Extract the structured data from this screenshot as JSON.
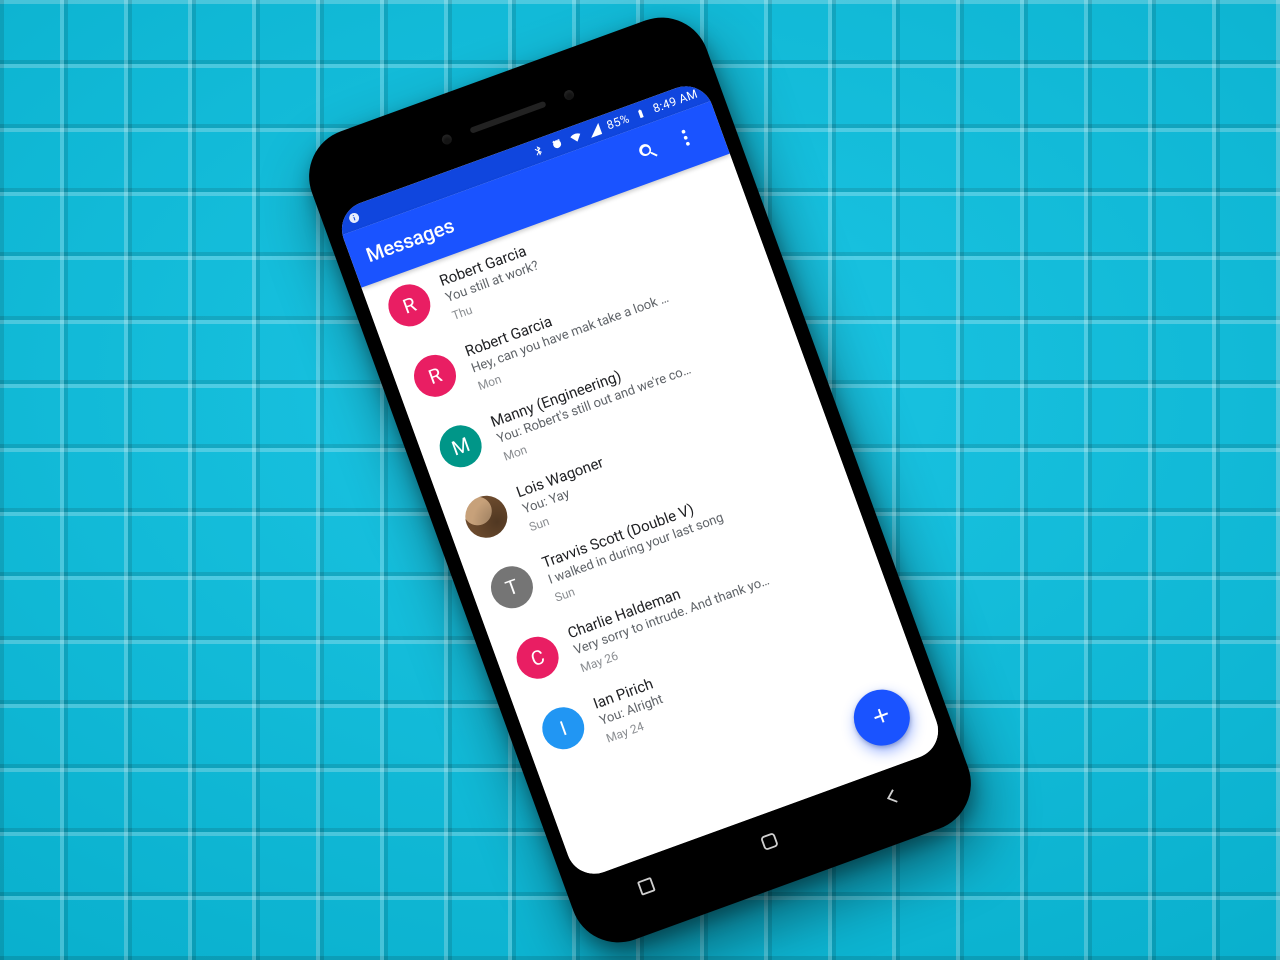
{
  "status": {
    "battery_text": "85%",
    "time_text": "8:49 AM"
  },
  "appbar": {
    "title": "Messages"
  },
  "fab": {
    "label": "+"
  },
  "avatar_palette": {
    "pink": "#e91e63",
    "teal": "#009688",
    "grey": "#757575",
    "blue": "#2196f3"
  },
  "conversations": [
    {
      "initial": "R",
      "color": "pink",
      "name": "Robert Garcia",
      "preview": "You still at work?",
      "date": "Thu"
    },
    {
      "initial": "R",
      "color": "pink",
      "name": "Robert Garcia",
      "preview": "Hey, can you have mak take a look …",
      "date": "Mon"
    },
    {
      "initial": "M",
      "color": "teal",
      "name": "Manny (Engineering)",
      "preview": "You: Robert's still out and we're co…",
      "date": "Mon"
    },
    {
      "initial": "",
      "photo": true,
      "name": "Lois Wagoner",
      "preview": "You: Yay",
      "date": "Sun"
    },
    {
      "initial": "T",
      "color": "grey",
      "name": "Travvis Scott (Double V)",
      "preview": "I walked in during your last song",
      "date": "Sun"
    },
    {
      "initial": "C",
      "color": "pink",
      "name": "Charlie Haldeman",
      "preview": "Very sorry to intrude. And thank yo…",
      "date": "May 26"
    },
    {
      "initial": "I",
      "color": "blue",
      "name": "Ian Pirich",
      "preview": "You: Alright",
      "date": "May 24"
    }
  ]
}
